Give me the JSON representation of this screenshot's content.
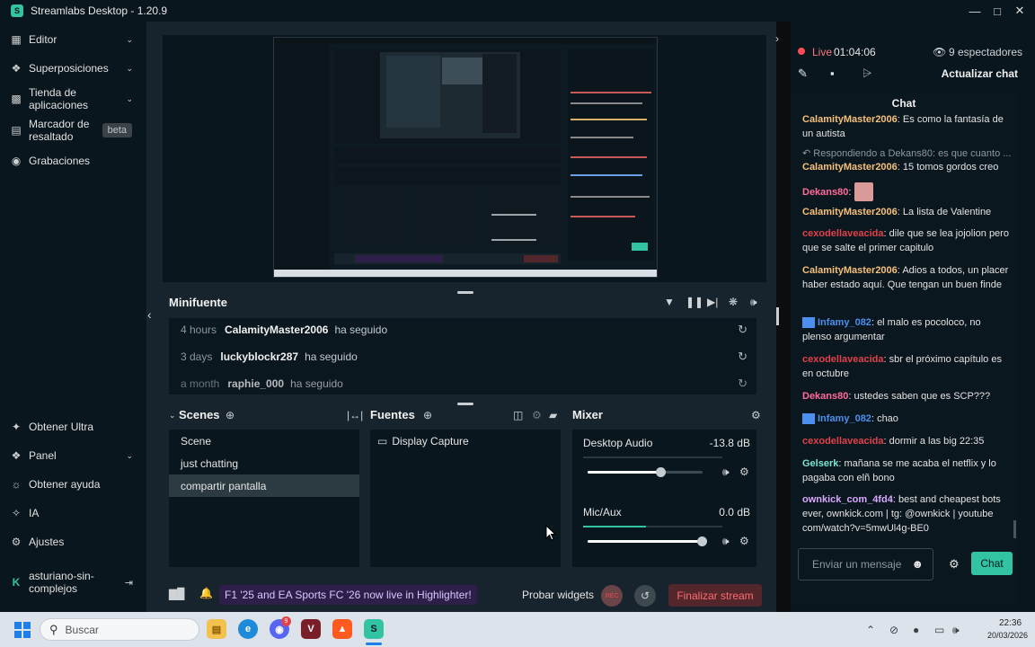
{
  "app": {
    "title": "Streamlabs Desktop - 1.20.9"
  },
  "sidebar": {
    "items": [
      {
        "label": "Editor",
        "icon": "editor-icon",
        "expandable": true
      },
      {
        "label": "Superposiciones",
        "icon": "overlays-icon",
        "expandable": true
      },
      {
        "label": "Tienda de aplicaciones",
        "icon": "app-store-icon",
        "expandable": true
      },
      {
        "label": "Marcador de resaltado",
        "icon": "highlighter-icon",
        "badge": "beta"
      },
      {
        "label": "Grabaciones",
        "icon": "recordings-icon"
      }
    ],
    "bottom_items": [
      {
        "label": "Obtener Ultra",
        "icon": "ultra-icon"
      },
      {
        "label": "Panel",
        "icon": "dashboard-icon",
        "expandable": true
      },
      {
        "label": "Obtener ayuda",
        "icon": "help-icon"
      },
      {
        "label": "IA",
        "icon": "ai-icon"
      },
      {
        "label": "Ajustes",
        "icon": "settings-icon"
      }
    ],
    "user": {
      "name": "asturiano-sin-complejos"
    }
  },
  "minifeed": {
    "title": "Minifuente",
    "events": [
      {
        "time": "4 hours",
        "user": "CalamityMaster2006",
        "action": "ha seguido"
      },
      {
        "time": "3 days",
        "user": "luckyblockr287",
        "action": "ha seguido"
      },
      {
        "time": "a month",
        "user": "raphie_000",
        "action": "ha seguido"
      }
    ]
  },
  "scenes": {
    "title": "Scenes",
    "items": [
      "Scene",
      "just chatting",
      "compartir pantalla"
    ],
    "selected": "compartir pantalla"
  },
  "sources": {
    "title": "Fuentes",
    "items": [
      {
        "label": "Display Capture",
        "icon": "monitor-icon"
      }
    ]
  },
  "mixer": {
    "title": "Mixer",
    "channels": [
      {
        "name": "Desktop Audio",
        "level": "-13.8 dB",
        "volume": 0.64,
        "meter": 0.0
      },
      {
        "name": "Mic/Aux",
        "level": "0.0 dB",
        "volume": 1.0,
        "meter": 0.45
      }
    ]
  },
  "footer": {
    "ticker": "F1 '25 and EA Sports FC '26 now live in Highlighter!",
    "test_widgets": "Probar widgets",
    "rec_label": "REC",
    "end_stream": "Finalizar stream"
  },
  "live": {
    "status": "Live",
    "duration": "01:04:06",
    "viewers": "9 espectadores",
    "refresh_chat": "Actualizar chat"
  },
  "chat": {
    "title": "Chat",
    "input_placeholder": "Enviar un mensaje",
    "send_label": "Chat",
    "messages": [
      {
        "user": "CalamityMaster2006",
        "color": "#f5c07a",
        "text": "Es como la fantasía de un autista"
      },
      {
        "reply": "Respondiendo a Dekans80: es que cuanto ...",
        "user": "CalamityMaster2006",
        "color": "#f5c07a",
        "text": "15 tomos gordos creo"
      },
      {
        "user": "Dekans80",
        "color": "#ff6b9a",
        "text": ""
      },
      {
        "user": "CalamityMaster2006",
        "color": "#f5c07a",
        "text": "La lista de Valentine"
      },
      {
        "user": "cexodellaveacida",
        "color": "#e0414a",
        "text": "dile que se lea jojolion pero que se salte el primer capitulo"
      },
      {
        "user": "CalamityMaster2006",
        "color": "#f5c07a",
        "text": "Adios a todos, un placer haber estado aquí. Que tengan un buen finde"
      },
      {
        "user": "Infamy_082",
        "color": "#4b8ff0",
        "text": "el malo es pocoloco, no plenso argumentar"
      },
      {
        "user": "cexodellaveacida",
        "color": "#e0414a",
        "text": "sbr el próximo capítulo es en octubre"
      },
      {
        "user": "Dekans80",
        "color": "#ff6b9a",
        "text": "ustedes saben que es SCP???"
      },
      {
        "user": "Infamy_082",
        "color": "#4b8ff0",
        "text": "chao"
      },
      {
        "user": "cexodellaveacida",
        "color": "#e0414a",
        "text": "dormir a las big 22:35"
      },
      {
        "user": "Gelserk",
        "color": "#7ce6d0",
        "text": "mañana se me acaba el netflix y lo pagaba con elñ bono"
      },
      {
        "user": "ownkick_com_4fd4",
        "color": "#d9a8ff",
        "text": "best and cheapest bots ever, ownkick.com | tg: @ownkick | youtube com/watch?v=5mwUl4g-BE0"
      }
    ]
  },
  "taskbar": {
    "search_placeholder": "Buscar",
    "time": "22:36",
    "date": "20/03/2026",
    "discord_badge": "9"
  }
}
